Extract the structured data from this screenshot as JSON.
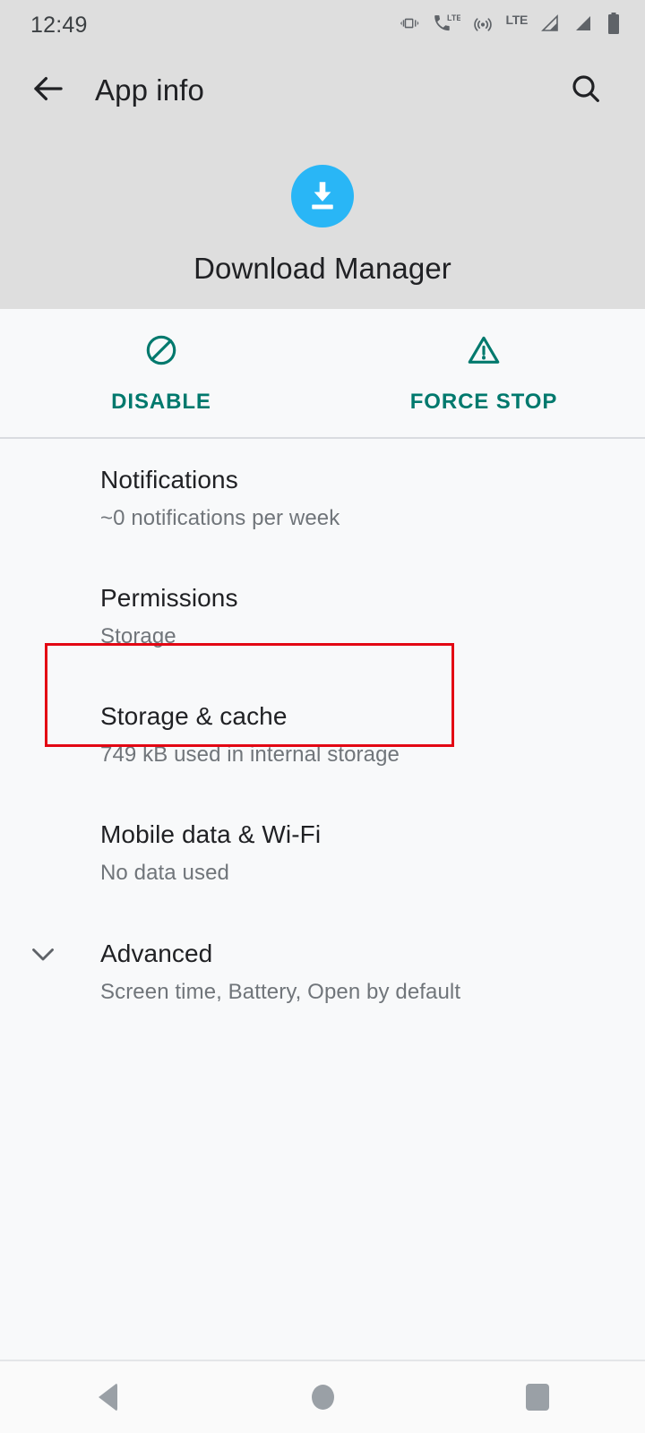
{
  "status_bar": {
    "time": "12:49",
    "icons": [
      {
        "name": "vibrate-icon",
        "label": "vibrate"
      },
      {
        "name": "volte-icon",
        "label": "VoLTE"
      },
      {
        "name": "hotspot-icon",
        "label": "hotspot"
      },
      {
        "name": "lte-label",
        "label": "LTE"
      },
      {
        "name": "signal-sim1-icon",
        "label": "signal 1"
      },
      {
        "name": "signal-sim2-icon",
        "label": "signal 2"
      },
      {
        "name": "battery-icon",
        "label": "battery"
      }
    ]
  },
  "app_bar": {
    "title": "App info",
    "back_icon": "arrow-back-icon",
    "search_icon": "search-icon"
  },
  "app_header": {
    "app_name": "Download Manager",
    "icon_name": "download-manager-icon",
    "icon_color": "#29b6f6"
  },
  "actions": {
    "accent_color": "#00796d",
    "buttons": [
      {
        "label": "DISABLE",
        "icon": "block-circle-slash-icon",
        "name": "disable-button"
      },
      {
        "label": "FORCE STOP",
        "icon": "warning-triangle-icon",
        "name": "force-stop-button"
      }
    ]
  },
  "settings_rows": [
    {
      "name": "row-notifications",
      "title": "Notifications",
      "subtitle": "~0 notifications per week",
      "chevron": false
    },
    {
      "name": "row-permissions",
      "title": "Permissions",
      "subtitle": "Storage",
      "chevron": false
    },
    {
      "name": "row-storage-cache",
      "title": "Storage & cache",
      "subtitle": "749 kB used in internal storage",
      "chevron": false
    },
    {
      "name": "row-mobile-data-wifi",
      "title": "Mobile data & Wi-Fi",
      "subtitle": "No data used",
      "chevron": false
    },
    {
      "name": "row-advanced",
      "title": "Advanced",
      "subtitle": "Screen time, Battery, Open by default",
      "chevron": true
    }
  ],
  "highlight": {
    "target": "Storage & cache",
    "color": "#e30613"
  },
  "nav_bar": {
    "back": "nav-back-icon",
    "home": "nav-home-icon",
    "recents": "nav-recents-icon"
  }
}
